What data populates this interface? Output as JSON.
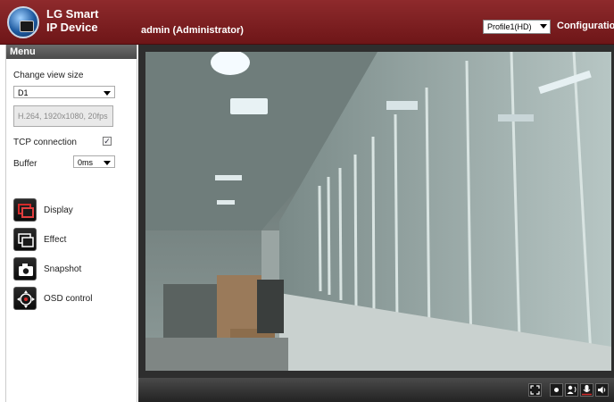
{
  "header": {
    "brand_line1": "LG Smart",
    "brand_line2": "IP Device",
    "user": "admin (Administrator)",
    "profile_selected": "Profile1(HD)",
    "config_label": "Configuration"
  },
  "sidebar": {
    "menu_title": "Menu",
    "view_size_label": "Change view size",
    "view_size_value": "D1",
    "codec_info": "H.264, 1920x1080, 20fps",
    "tcp_label": "TCP connection",
    "tcp_checked": true,
    "buffer_label": "Buffer",
    "buffer_value": "0ms",
    "actions": [
      {
        "label": "Display",
        "icon": "display-icon"
      },
      {
        "label": "Effect",
        "icon": "effect-icon"
      },
      {
        "label": "Snapshot",
        "icon": "camera-icon"
      },
      {
        "label": "OSD control",
        "icon": "osd-control-icon"
      }
    ]
  },
  "controls": [
    "fullscreen-icon",
    "record-icon",
    "talk-icon",
    "microphone-icon",
    "speaker-icon"
  ],
  "colors": {
    "header": "#7c1d1f",
    "accent_red": "#c41e24",
    "panel_dark": "#2e2e2e"
  }
}
